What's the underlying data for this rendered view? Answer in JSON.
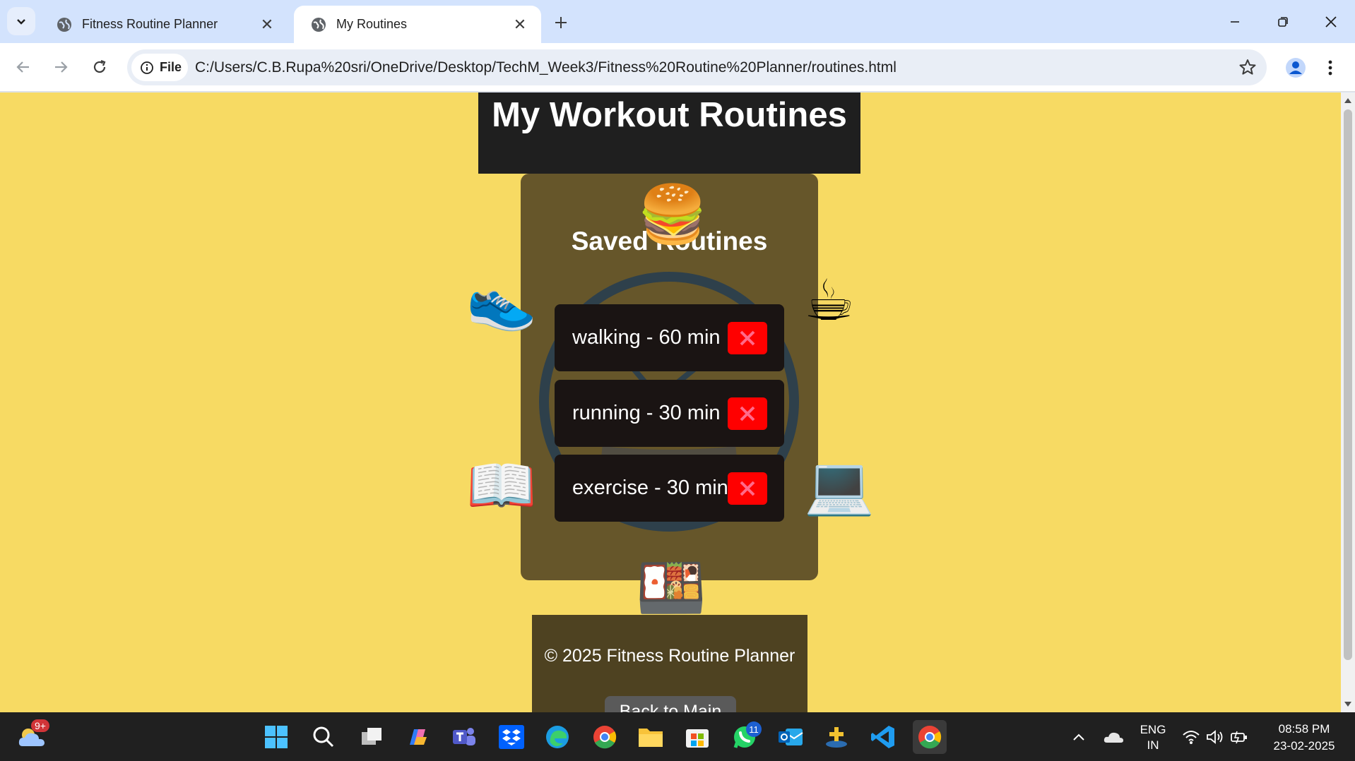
{
  "browser": {
    "tabs": [
      {
        "title": "Fitness Routine Planner",
        "active": false
      },
      {
        "title": "My Routines",
        "active": true
      }
    ],
    "address": {
      "scheme_chip": "File",
      "url": "C:/Users/C.B.Rupa%20sri/OneDrive/Desktop/TechM_Week3/Fitness%20Routine%20Planner/routines.html"
    }
  },
  "page": {
    "header_title": "My Workout Routines",
    "card_title": "Saved Routines",
    "routines": [
      {
        "text": "walking - 60 min"
      },
      {
        "text": "running - 30 min"
      },
      {
        "text": "exercise - 30 min"
      }
    ],
    "delete_glyph": "✕",
    "decorations": {
      "burger": "🍔",
      "shoe": "👟",
      "coffee": "☕",
      "book": "📖",
      "laptop": "💻",
      "bento": "🍱"
    },
    "footer_text": "© 2025 Fitness Routine Planner",
    "back_button": "Back to Main"
  },
  "taskbar": {
    "weather_badge": "9+",
    "whatsapp_badge": "11",
    "language": {
      "line1": "ENG",
      "line2": "IN"
    },
    "time": "08:58 PM",
    "date": "23-02-2025"
  },
  "colors": {
    "page_bg": "#f7da63",
    "header_bg": "#1f1f1f",
    "card_bg": "#66562a",
    "routine_bg": "#1a1413",
    "delete_bg": "#ff0000",
    "tabstrip_bg": "#d3e3fd"
  }
}
